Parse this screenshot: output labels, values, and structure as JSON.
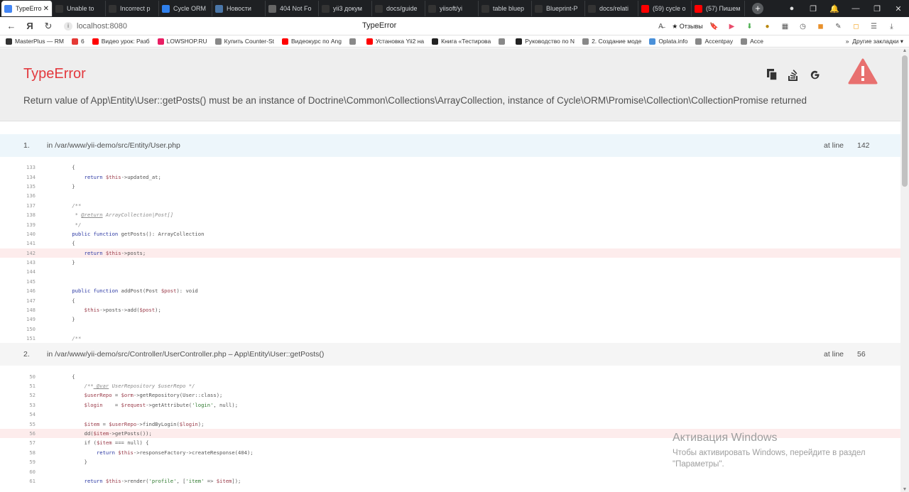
{
  "browser": {
    "tabs": [
      {
        "label": "TypeError",
        "color": "#4285f4",
        "icon": "app-grid-icon"
      },
      {
        "label": "Unable to",
        "color": "#333333",
        "icon": "github-icon"
      },
      {
        "label": "Incorrect p",
        "color": "#333333",
        "icon": "github-icon"
      },
      {
        "label": "Cycle ORM",
        "color": "#2f80ed",
        "icon": "globe-icon"
      },
      {
        "label": "Новости",
        "color": "#4a76a8",
        "icon": "vk-icon"
      },
      {
        "label": "404 Not Fo",
        "color": "#666666",
        "icon": "page-icon"
      },
      {
        "label": "yii3 докум",
        "color": "#333333",
        "icon": "globe-icon"
      },
      {
        "label": "docs/guide",
        "color": "#333333",
        "icon": "github-icon"
      },
      {
        "label": "yiisoft/yi",
        "color": "#333333",
        "icon": "github-icon"
      },
      {
        "label": "table bluep",
        "color": "#333333",
        "icon": "globe-icon"
      },
      {
        "label": "Blueprint-P",
        "color": "#333333",
        "icon": "github-icon"
      },
      {
        "label": "docs/relati",
        "color": "#333333",
        "icon": "github-icon"
      },
      {
        "label": "(59) cycle o",
        "color": "#ff0000",
        "icon": "youtube-icon"
      },
      {
        "label": "(57) Пишем",
        "color": "#ff0000",
        "icon": "youtube-icon"
      }
    ],
    "address": "localhost:8080",
    "page_title": "TypeError",
    "reviews_label": "★ Отзывы",
    "bookmarks": [
      {
        "label": "MasterPlus — RM",
        "color": "#333333"
      },
      {
        "label": "6",
        "color": "#e53935"
      },
      {
        "label": "Видео урок: Разб",
        "color": "#ff0000"
      },
      {
        "label": "LOWSHOP.RU",
        "color": "#e91e63"
      },
      {
        "label": "Купить Counter-St",
        "color": "#888888"
      },
      {
        "label": "Видеокурс по Ang",
        "color": "#ff0000"
      },
      {
        "label": "",
        "color": "#888888"
      },
      {
        "label": "Установка Yii2 на",
        "color": "#ff0000"
      },
      {
        "label": "Книга «Тестирова",
        "color": "#222222"
      },
      {
        "label": "",
        "color": "#888888"
      },
      {
        "label": "Руководство по N",
        "color": "#222222"
      },
      {
        "label": "2. Создание моде",
        "color": "#888888"
      },
      {
        "label": "Oplata.info",
        "color": "#4a90d9"
      },
      {
        "label": "Accentpay",
        "color": "#888888"
      },
      {
        "label": "Acce",
        "color": "#888888"
      }
    ],
    "other_bookmarks": "Другие закладки"
  },
  "error": {
    "title": "TypeError",
    "message": "Return value of App\\Entity\\User::getPosts() must be an instance of Doctrine\\Common\\Collections\\ArrayCollection, instance of Cycle\\ORM\\Promise\\Collection\\CollectionPromise returned"
  },
  "frames": [
    {
      "number": "1.",
      "path": "in /var/www/yii-demo/src/Entity/User.php",
      "at_line_label": "at line",
      "line": "142",
      "highlight": "142",
      "code": [
        {
          "n": "133",
          "html": "    {"
        },
        {
          "n": "134",
          "html": "        <span class=\"k\">return</span> <span class=\"v\">$this</span>->updated_at;"
        },
        {
          "n": "135",
          "html": "    }"
        },
        {
          "n": "136",
          "html": ""
        },
        {
          "n": "137",
          "html": "    <span class=\"c\">/**</span>"
        },
        {
          "n": "138",
          "html": "     <span class=\"c\">* <u>@return</u> ArrayCollection|Post[]</span>"
        },
        {
          "n": "139",
          "html": "     <span class=\"c\">*/</span>"
        },
        {
          "n": "140",
          "html": "    <span class=\"k\">public function</span> getPosts(): ArrayCollection"
        },
        {
          "n": "141",
          "html": "    {"
        },
        {
          "n": "142",
          "html": "        <span class=\"k\">return</span> <span class=\"v\">$this</span>->posts;"
        },
        {
          "n": "143",
          "html": "    }"
        },
        {
          "n": "144",
          "html": ""
        },
        {
          "n": "145",
          "html": ""
        },
        {
          "n": "146",
          "html": "    <span class=\"k\">public function</span> addPost(Post <span class=\"v\">$post</span>): void"
        },
        {
          "n": "147",
          "html": "    {"
        },
        {
          "n": "148",
          "html": "        <span class=\"v\">$this</span>->posts->add(<span class=\"v\">$post</span>);"
        },
        {
          "n": "149",
          "html": "    }"
        },
        {
          "n": "150",
          "html": ""
        },
        {
          "n": "151",
          "html": "    <span class=\"c\">/**</span>"
        }
      ]
    },
    {
      "number": "2.",
      "path": "in /var/www/yii-demo/src/Controller/UserController.php – App\\Entity\\User::getPosts()",
      "at_line_label": "at line",
      "line": "56",
      "highlight": "56",
      "code": [
        {
          "n": "50",
          "html": "    {"
        },
        {
          "n": "51",
          "html": "        <span class=\"c\">/**<u> @var</u> UserRepository $userRepo */</span>"
        },
        {
          "n": "52",
          "html": "        <span class=\"v\">$userRepo</span> = <span class=\"v\">$orm</span>->getRepository(User::class);"
        },
        {
          "n": "53",
          "html": "        <span class=\"v\">$login</span>    = <span class=\"v\">$request</span>->getAttribute(<span class=\"s\">'login'</span>, null);"
        },
        {
          "n": "54",
          "html": ""
        },
        {
          "n": "55",
          "html": "        <span class=\"v\">$item</span> = <span class=\"v\">$userRepo</span>->findByLogin(<span class=\"v\">$login</span>);"
        },
        {
          "n": "56",
          "html": "        dd(<span class=\"v\">$item</span>->getPosts());"
        },
        {
          "n": "57",
          "html": "        if (<span class=\"v\">$item</span> === null) {"
        },
        {
          "n": "58",
          "html": "            <span class=\"k\">return</span> <span class=\"v\">$this</span>->responseFactory->createResponse(404);"
        },
        {
          "n": "59",
          "html": "        }"
        },
        {
          "n": "60",
          "html": ""
        },
        {
          "n": "61",
          "html": "        <span class=\"k\">return</span> <span class=\"v\">$this</span>->render(<span class=\"s\">'profile'</span>, [<span class=\"s\">'item'</span> => <span class=\"v\">$item</span>]);"
        }
      ]
    }
  ],
  "watermark": {
    "title": "Активация Windows",
    "line1": "Чтобы активировать Windows, перейдите в раздел",
    "line2": "\"Параметры\"."
  },
  "colors": {
    "error_red": "#e3393e",
    "frame_header_active": "#edf6fb",
    "frame_header": "#f5f5f5",
    "highlight_line": "#fdecec"
  }
}
